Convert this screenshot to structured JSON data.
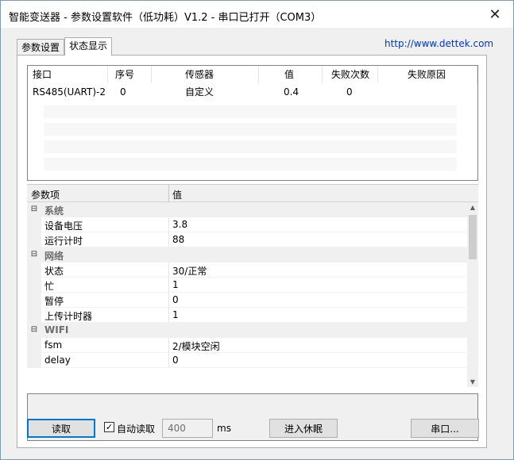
{
  "window": {
    "title": "智能变送器 - 参数设置软件（低功耗）V1.2 - 串口已打开（COM3）",
    "close_glyph": "✕"
  },
  "tabs": [
    {
      "label": "参数设置",
      "active": false
    },
    {
      "label": "状态显示",
      "active": true
    }
  ],
  "url": "http://www.dettek.com",
  "sensor_table": {
    "columns": [
      "接口",
      "序号",
      "传感器",
      "值",
      "失败次数",
      "失败原因"
    ],
    "rows": [
      {
        "iface": "RS485(UART)-2",
        "index": "0",
        "sensor": "自定义",
        "value": "0.4",
        "fail_count": "0",
        "fail_reason": ""
      }
    ]
  },
  "property_grid": {
    "header": {
      "name": "参数项",
      "value": "值"
    },
    "expander_glyph": "⊟",
    "groups": [
      {
        "name": "系统",
        "items": [
          {
            "name": "设备电压",
            "value": "3.8"
          },
          {
            "name": "运行计时",
            "value": "88"
          }
        ]
      },
      {
        "name": "网络",
        "items": [
          {
            "name": "状态",
            "value": "30/正常"
          },
          {
            "name": "忙",
            "value": "1"
          },
          {
            "name": "暂停",
            "value": "0"
          },
          {
            "name": "上传计时器",
            "value": "1"
          }
        ]
      },
      {
        "name": "WIFI",
        "items": [
          {
            "name": "fsm",
            "value": "2/模块空闲"
          },
          {
            "name": "delay",
            "value": "0"
          }
        ]
      }
    ]
  },
  "bottom": {
    "read_label": "读取",
    "auto_read_label": "自动读取",
    "auto_read_checked": true,
    "interval_value": "400",
    "unit": "ms",
    "sleep_label": "进入休眠",
    "serial_label": "串口..."
  }
}
